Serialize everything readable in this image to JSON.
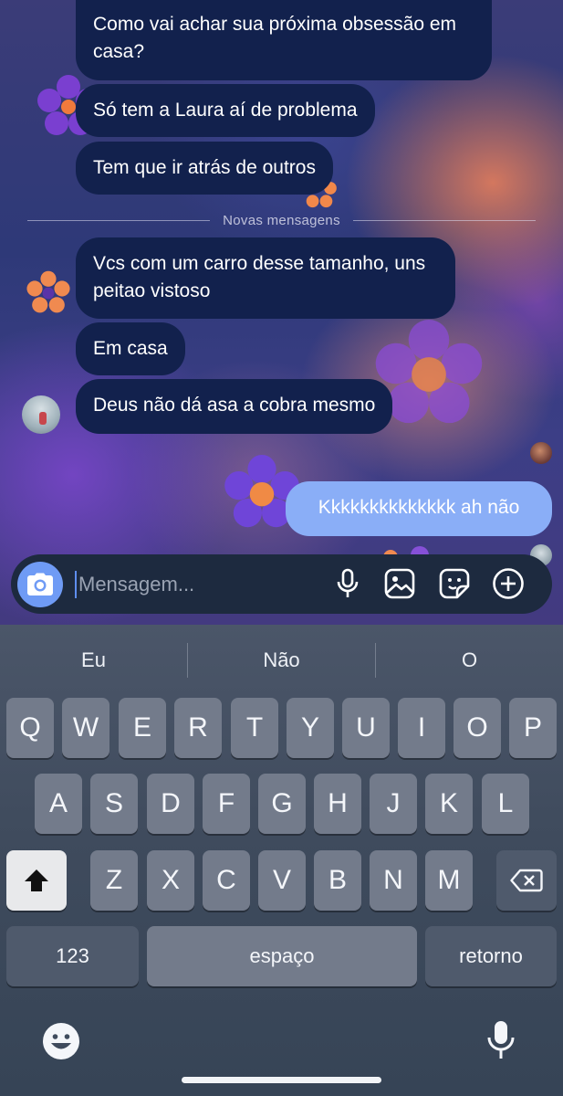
{
  "chat": {
    "messages_received": [
      {
        "id": "m1",
        "text": "Como vai achar sua próxima obsessão em casa?"
      },
      {
        "id": "m2",
        "text": "Só tem a Laura aí de problema"
      },
      {
        "id": "m3",
        "text": "Tem que ir atrás de outros"
      },
      {
        "id": "m4",
        "text": "Vcs com um carro desse tamanho, uns peitao vistoso"
      },
      {
        "id": "m5",
        "text": "Em casa"
      },
      {
        "id": "m6",
        "text": "Deus não dá asa a cobra mesmo"
      }
    ],
    "new_messages_divider": "Novas mensagens",
    "message_sent": "Kkkkkkkkkkkkkk ah não"
  },
  "composer": {
    "placeholder": "Mensagem...",
    "icons": [
      "camera-icon",
      "microphone-icon",
      "gallery-icon",
      "sticker-icon",
      "add-icon"
    ]
  },
  "keyboard": {
    "suggestions": [
      "Eu",
      "Não",
      "O"
    ],
    "row1": [
      "Q",
      "W",
      "E",
      "R",
      "T",
      "Y",
      "U",
      "I",
      "O",
      "P"
    ],
    "row2": [
      "A",
      "S",
      "D",
      "F",
      "G",
      "H",
      "J",
      "K",
      "L"
    ],
    "row3": [
      "Z",
      "X",
      "C",
      "V",
      "B",
      "N",
      "M"
    ],
    "numbers_key": "123",
    "space_key": "espaço",
    "return_key": "retorno",
    "icons": [
      "shift-icon",
      "backspace-icon",
      "emoji-icon",
      "dictation-icon"
    ]
  },
  "colors": {
    "received_bubble": "#12214d",
    "sent_bubble": "#8aaef7",
    "accent": "#6f9bf5"
  }
}
